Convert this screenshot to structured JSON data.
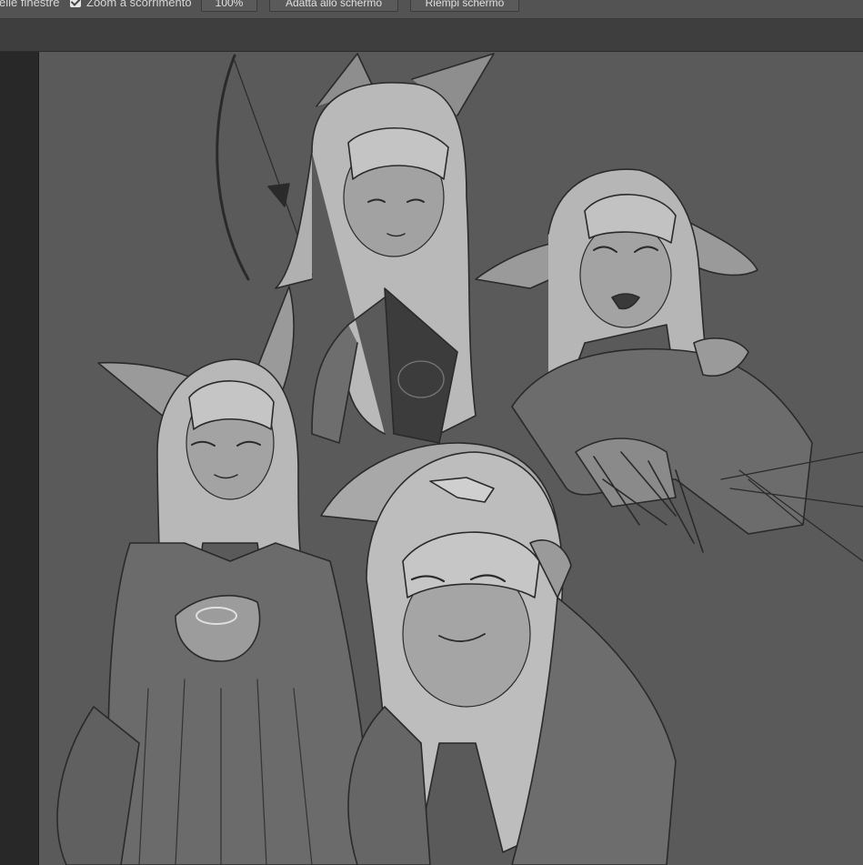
{
  "options_bar": {
    "window_option_label": "elle finestre",
    "scrubby_zoom_label": "Zoom a scorrimento",
    "scrubby_zoom_checked": true,
    "zoom_level": "100%",
    "fit_screen_label": "Adatta allo schermo",
    "fill_screen_label": "Riempi schermo"
  },
  "colors": {
    "panel": "#535353",
    "tab_strip": "#3e3e3e",
    "tools_panel": "#282828",
    "canvas_background": "#5a5a5a"
  }
}
